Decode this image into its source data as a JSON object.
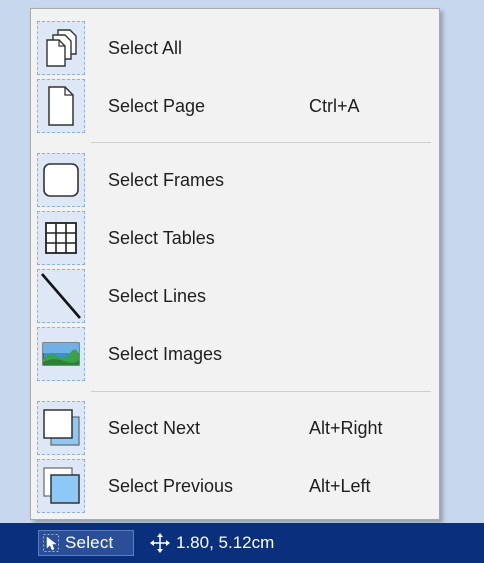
{
  "menu": {
    "items": [
      {
        "label": "Select All",
        "shortcut": "",
        "icon": "select-all-icon"
      },
      {
        "label": "Select Page",
        "shortcut": "Ctrl+A",
        "icon": "page-icon"
      },
      {
        "label": "Select Frames",
        "shortcut": "",
        "icon": "frame-icon"
      },
      {
        "label": "Select Tables",
        "shortcut": "",
        "icon": "table-icon"
      },
      {
        "label": "Select Lines",
        "shortcut": "",
        "icon": "line-icon"
      },
      {
        "label": "Select Images",
        "shortcut": "",
        "icon": "image-icon"
      },
      {
        "label": "Select Next",
        "shortcut": "Alt+Right",
        "icon": "select-next-icon"
      },
      {
        "label": "Select Previous",
        "shortcut": "Alt+Left",
        "icon": "select-previous-icon"
      }
    ]
  },
  "statusbar": {
    "select_label": "Select",
    "coords": "1.80, 5.12cm"
  },
  "colors": {
    "statusbar_bg": "#0a2f7c",
    "menu_bg": "#f2f2f2",
    "icon_highlight": "#dde7f5",
    "backdrop": "#c6d7ee"
  }
}
